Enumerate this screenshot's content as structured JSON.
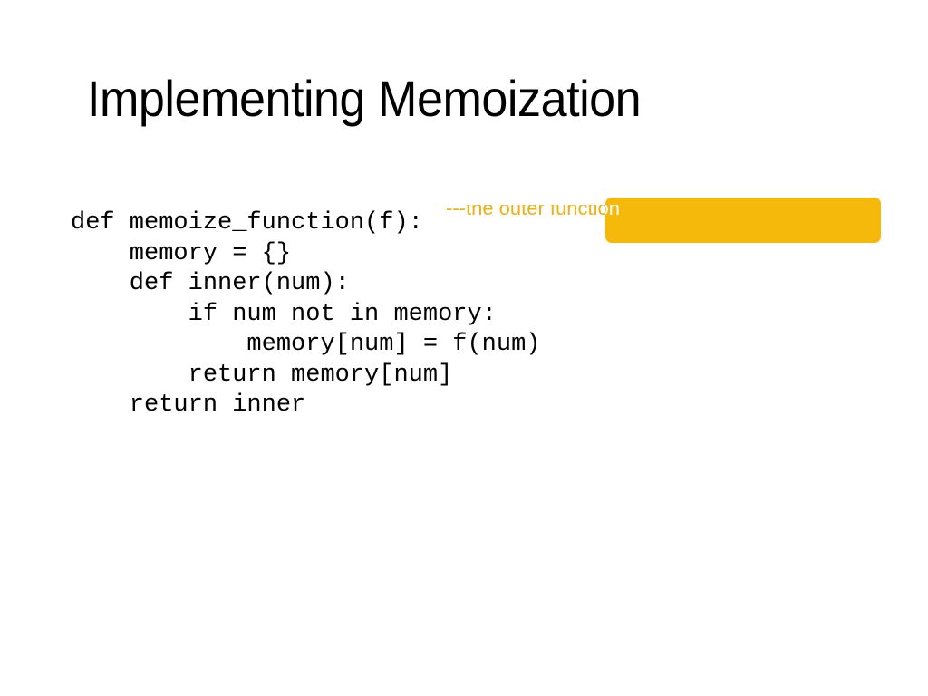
{
  "slide": {
    "title": "Implementing Memoization",
    "background_color": "#FFFFFF",
    "title_color": "#000000"
  },
  "code": {
    "language": "python",
    "text_color": "#000000",
    "lines": [
      "def memoize_function(f):",
      "    memory = {}",
      "    def inner(num):",
      "        if num not in memory:",
      "            memory[num] = f(num)",
      "        return memory[num]",
      "    return inner"
    ]
  },
  "annotation": {
    "text": "---the outer function",
    "color": "#EFB111",
    "knockout_color": "#FFFFFF"
  },
  "callout": {
    "box_color": "#F5B90B",
    "label": ""
  }
}
